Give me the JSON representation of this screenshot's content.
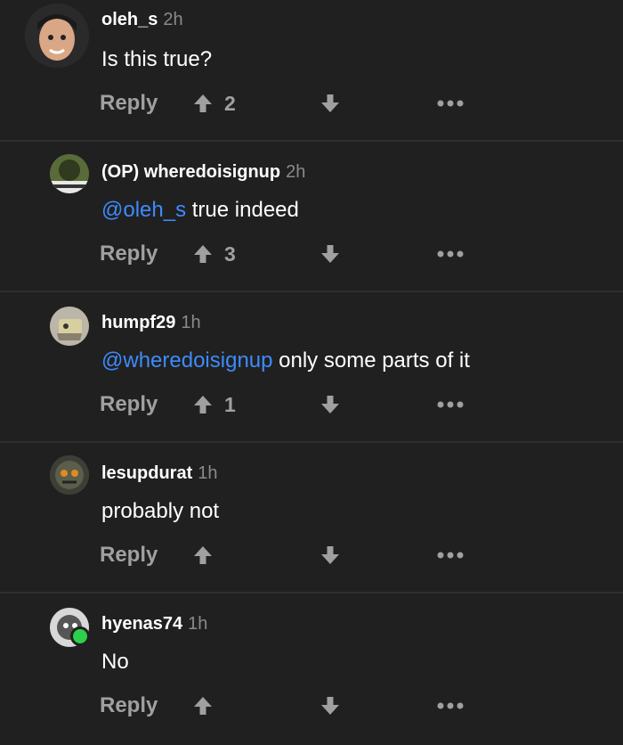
{
  "comments": [
    {
      "username": "oleh_s",
      "time": "2h",
      "mention": "",
      "text": "Is this true?",
      "reply_label": "Reply",
      "upvotes": "2"
    },
    {
      "username": "(OP) wheredoisignup",
      "time": "2h",
      "mention": "@oleh_s",
      "text": " true indeed",
      "reply_label": "Reply",
      "upvotes": "3"
    },
    {
      "username": "humpf29",
      "time": "1h",
      "mention": "@wheredoisignup",
      "text": " only some parts of it",
      "reply_label": "Reply",
      "upvotes": "1"
    },
    {
      "username": "lesupdurat",
      "time": "1h",
      "mention": "",
      "text": "probably not",
      "reply_label": "Reply",
      "upvotes": ""
    },
    {
      "username": "hyenas74",
      "time": "1h",
      "mention": "",
      "text": "No",
      "reply_label": "Reply",
      "upvotes": ""
    }
  ],
  "icons": {
    "upvote": "arrow-up-icon",
    "downvote": "arrow-down-icon",
    "more": "more-dots-icon"
  },
  "colors": {
    "background": "#202020",
    "mention": "#3d8bfd",
    "muted": "#a0a0a0",
    "online": "#2bd14a"
  }
}
